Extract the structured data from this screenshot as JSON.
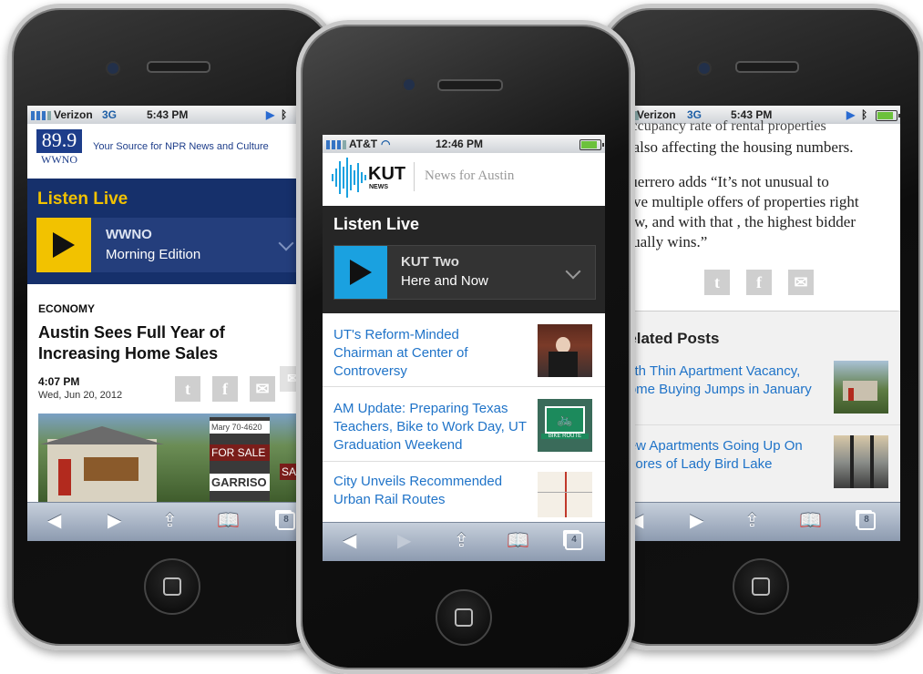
{
  "left_phone": {
    "status": {
      "carrier": "Verizon",
      "network": "3G",
      "time": "5:43 PM"
    },
    "header": {
      "logo_text": "89.9",
      "logo_sub": "WWNO",
      "tagline": "Your Source for NPR News and Culture"
    },
    "listen_live": "Listen Live",
    "station": "WWNO",
    "program": "Morning Edition",
    "category": "ECONOMY",
    "headline": "Austin Sees Full Year of Increasing Home Sales",
    "time": "4:07 PM",
    "date": "Wed, Jun 20, 2012",
    "image_signs": {
      "sign1": "FOR SALE",
      "sign2": "GARRISO",
      "sign3": "SAL",
      "phone": "Mary 70-4620"
    },
    "tabs_count": "8"
  },
  "center_phone": {
    "status": {
      "carrier": "AT&T",
      "time": "12:46 PM"
    },
    "header": {
      "logo_text": "KUT",
      "logo_sub": "NEWS",
      "tagline": "News for Austin"
    },
    "listen_live": "Listen Live",
    "station": "KUT Two",
    "program": "Here and Now",
    "stories": [
      {
        "title": "UT's Reform-Minded Chairman at Center of Controversy"
      },
      {
        "title": "AM Update: Preparing Texas Teachers, Bike to Work Day, UT Graduation Weekend",
        "thumb_text": "BIKE ROUTE"
      },
      {
        "title": "City Unveils Recommended Urban Rail Routes"
      }
    ],
    "tabs_count": "4"
  },
  "right_phone": {
    "status": {
      "carrier": "Verizon",
      "network": "3G",
      "time": "5:43 PM"
    },
    "article_top": "Occupancy rate of rental properties",
    "article_lines": [
      "is also affecting the housing numbers.",
      "Guerrero adds “It’s not unusual to",
      "have multiple offers of properties right",
      "now, and with that , the highest bidder",
      "usually wins.”"
    ],
    "related_title": "Related Posts",
    "related": [
      {
        "title": "With Thin Apartment Vacancy, Home Buying Jumps in January"
      },
      {
        "title": "New Apartments Going Up On Shores of Lady Bird Lake"
      }
    ],
    "tabs_count": "8"
  },
  "colors": {
    "wwno_blue": "#16306b",
    "wwno_yellow": "#f2c200",
    "kut_blue": "#1aa1e0",
    "kut_dark": "#262626",
    "link_blue": "#1f73c8"
  }
}
